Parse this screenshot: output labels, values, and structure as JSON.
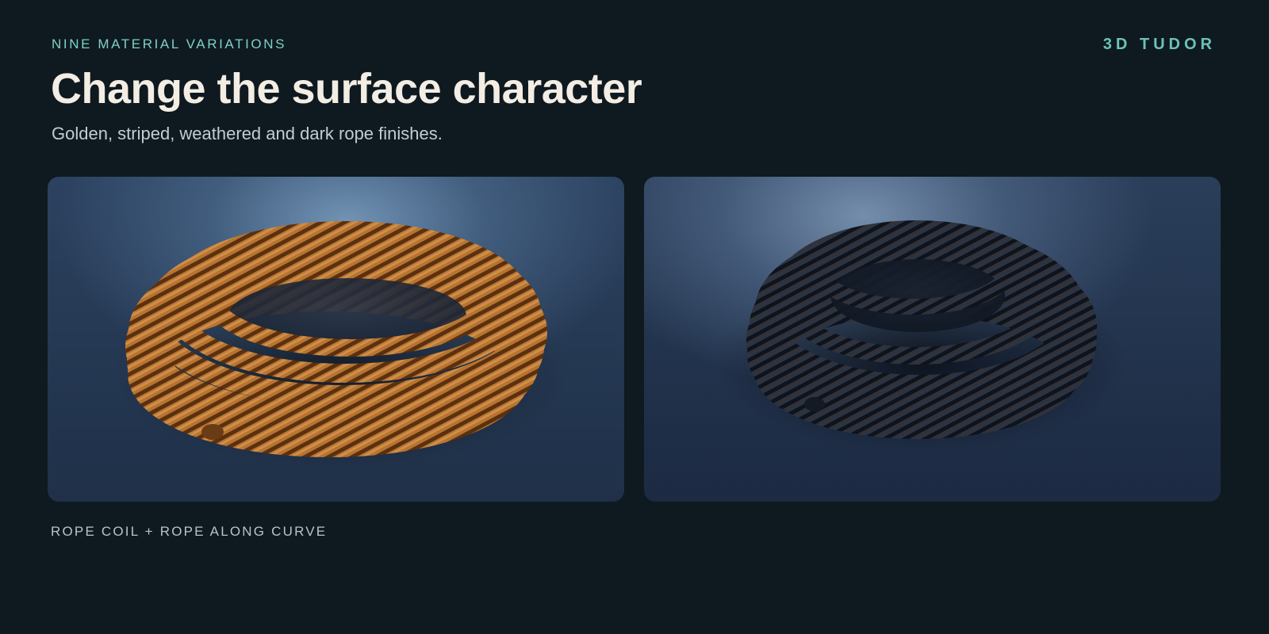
{
  "header": {
    "eyebrow": "NINE MATERIAL VARIATIONS",
    "brand": "3D TUDOR",
    "title": "Change the surface character",
    "subtitle": "Golden, striped, weathered and dark rope finishes."
  },
  "gallery": {
    "images": [
      {
        "name": "golden-rope-coil",
        "finish": "golden",
        "rope_color": "#b8742f"
      },
      {
        "name": "dark-rope-coil",
        "finish": "dark",
        "rope_color": "#2a3444"
      }
    ]
  },
  "footer": {
    "caption": "ROPE COIL + ROPE ALONG CURVE"
  },
  "colors": {
    "background": "#0e1a20",
    "accent": "#7fd0c6",
    "title": "#f3ede4"
  }
}
